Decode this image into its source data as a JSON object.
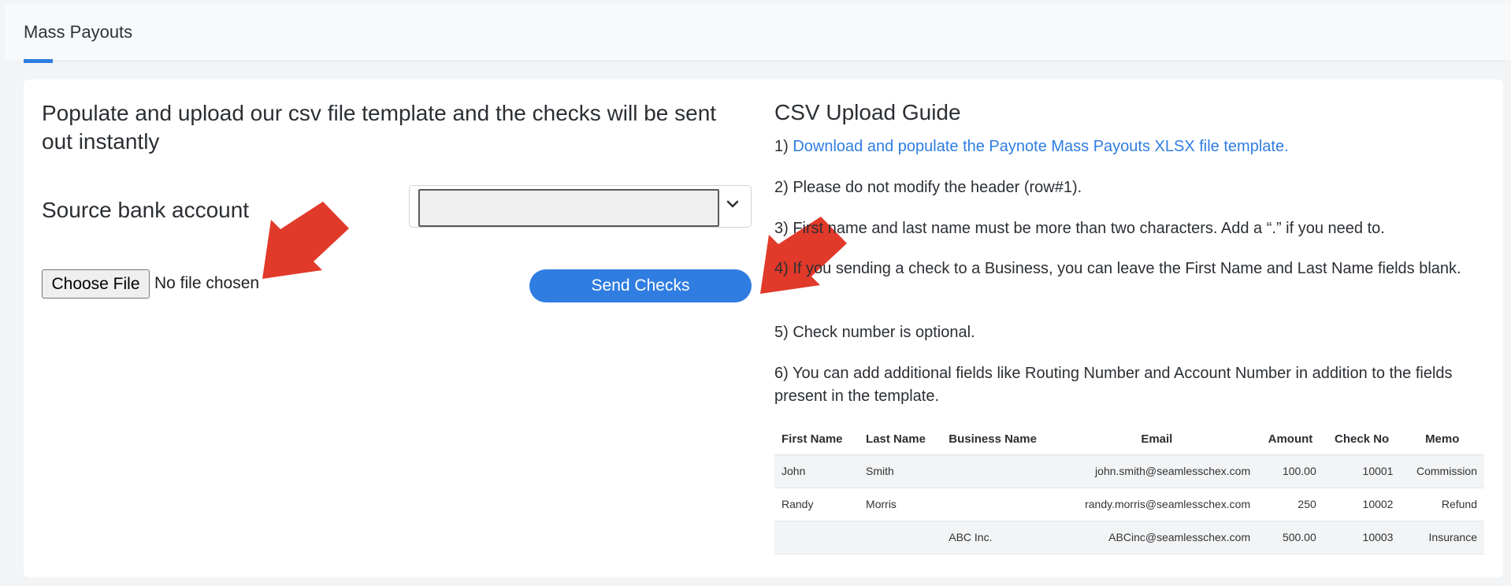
{
  "header": {
    "tab_label": "Mass Payouts"
  },
  "upload": {
    "lead": "Populate and upload our csv file template and the checks will be sent out instantly",
    "source_label": "Source bank account",
    "select_value": "",
    "file_button": "Choose File",
    "file_status": "No file chosen",
    "send_button": "Send Checks"
  },
  "guide": {
    "title": "CSV Upload Guide",
    "step1_prefix": "1) ",
    "step1_link": "Download and populate the Paynote Mass Payouts XLSX file template.",
    "step2": "2) Please do not modify the header (row#1).",
    "step3": "3) First name and last name must be more than two characters. Add a “.” if you need to.",
    "step4": "4) If you sending a check to a Business, you can leave the First Name and Last Name fields blank.",
    "step5": "5) Check number is optional.",
    "step6": "6) You can add additional fields like Routing Number and Account Number in addition to the fields present in the template."
  },
  "table": {
    "headers": [
      "First Name",
      "Last Name",
      "Business Name",
      "Email",
      "Amount",
      "Check No",
      "Memo"
    ],
    "rows": [
      [
        "John",
        "Smith",
        "",
        "john.smith@seamlesschex.com",
        "100.00",
        "10001",
        "Commission"
      ],
      [
        "Randy",
        "Morris",
        "",
        "randy.morris@seamlesschex.com",
        "250",
        "10002",
        "Refund"
      ],
      [
        "",
        "",
        "ABC Inc.",
        "ABCinc@seamlesschex.com",
        "500.00",
        "10003",
        "Insurance"
      ]
    ]
  },
  "colors": {
    "accent": "#2f7de1",
    "arrow": "#e1392a"
  },
  "icons": [
    "chevron-down-icon",
    "red-arrow-annotation"
  ]
}
